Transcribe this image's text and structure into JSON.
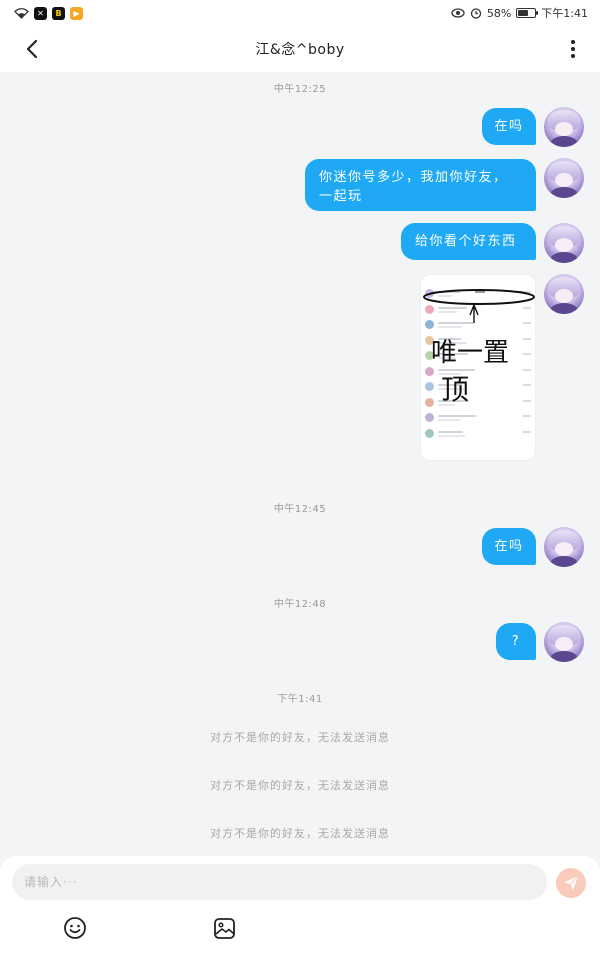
{
  "status_bar": {
    "battery": "58%",
    "time": "下午1:41",
    "icons": [
      "wifi-icon",
      "capcut-app-icon",
      "baidu-app-icon",
      "video-app-icon",
      "eye-comfort-icon",
      "alarm-icon",
      "battery-icon"
    ],
    "battery_level": 0.58
  },
  "header": {
    "title": "江&念^boby",
    "back_icon": "chevron-left-icon",
    "more_icon": "more-vertical-icon"
  },
  "messages": {
    "time_1": "中午12:25",
    "msg_1": "在吗",
    "msg_2_line1": "你迷你号多少，我加你好友，",
    "msg_2_line2": "一起玩",
    "msg_3": "给你看个好东西",
    "image_annotation_line1": "唯一置",
    "image_annotation_line2": "顶",
    "time_2": "中午12:45",
    "msg_4": "在吗",
    "time_3": "中午12:48",
    "msg_5": "?",
    "time_4": "下午1:41",
    "system_notes": [
      "对方不是你的好友，无法发送消息",
      "对方不是你的好友，无法发送消息",
      "对方不是你的好友，无法发送消息"
    ]
  },
  "input": {
    "placeholder": "请输入···",
    "send_icon": "send-icon",
    "emoji_icon": "emoji-icon",
    "image_icon": "image-icon"
  },
  "colors": {
    "bubble": "#1fa9f4",
    "background": "#f3f4f6",
    "send_button": "#f9cbbd"
  }
}
